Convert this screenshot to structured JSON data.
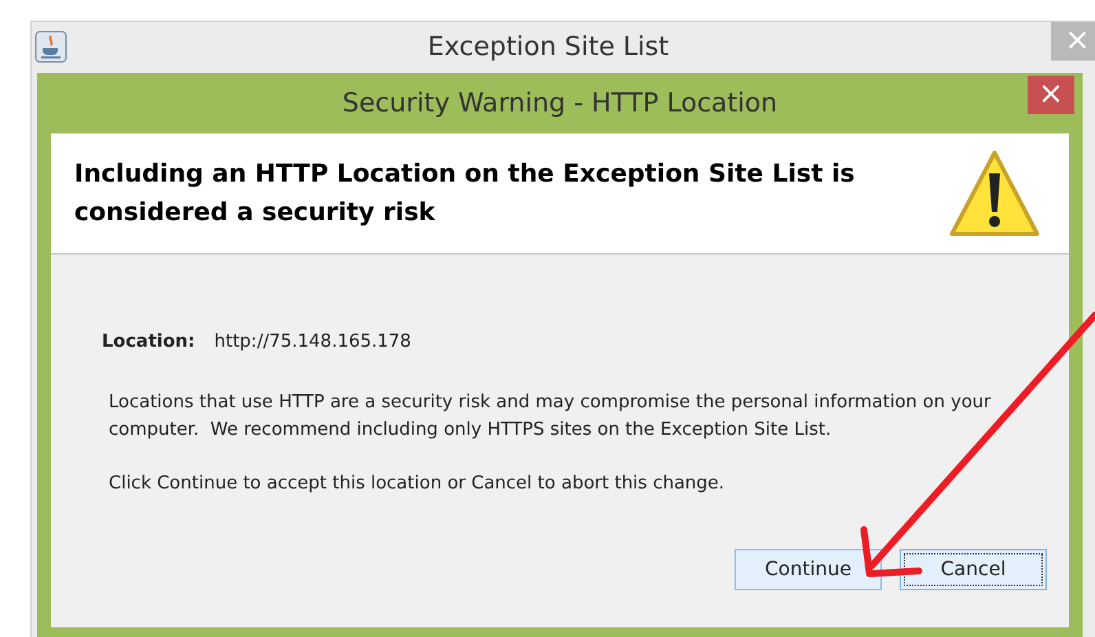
{
  "window": {
    "title": "Exception Site List",
    "close": "×"
  },
  "dialog": {
    "title": "Security Warning - HTTP Location",
    "close": "×",
    "heading": "Including an HTTP Location on the Exception Site List is considered a security risk",
    "location_label": "Location:",
    "location_value": "http://75.148.165.178",
    "message": "Locations that use HTTP are a security risk and may compromise the personal information on your computer.  We recommend including only HTTPS sites on the Exception Site List.",
    "instruction": "Click Continue to accept this location or Cancel to abort this change.",
    "buttons": [
      {
        "label": "Continue",
        "focused": false
      },
      {
        "label": "Cancel",
        "focused": true
      }
    ]
  }
}
